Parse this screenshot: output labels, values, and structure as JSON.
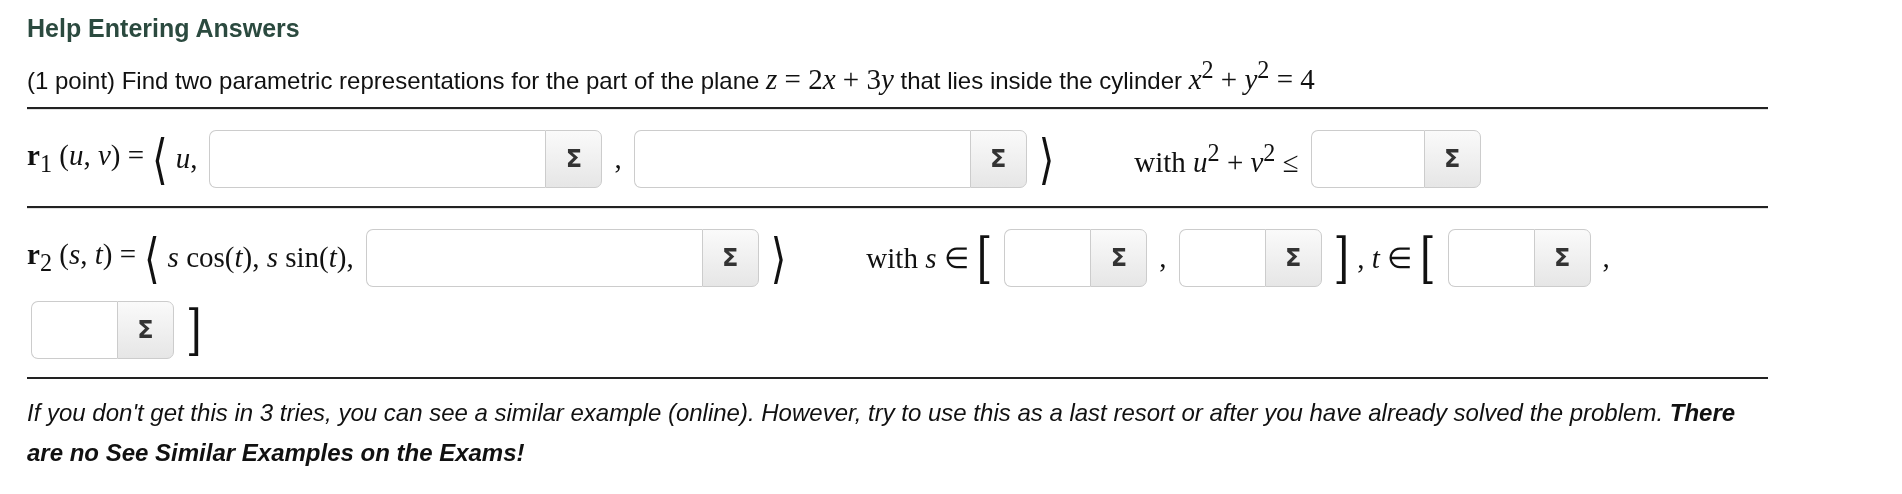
{
  "heading": "Help Entering Answers",
  "problem": [
    {
      "kind": "text",
      "text": "(1 point) Find two parametric representations for the part of the plane "
    },
    {
      "kind": "math",
      "text": "*z* = 2"
    },
    {
      "kind": "math",
      "text": "*x*"
    },
    {
      "kind": "math",
      "text": " + 3"
    },
    {
      "kind": "math",
      "text": "*y*"
    },
    {
      "kind": "text",
      "text": " that lies inside the cylinder "
    },
    {
      "kind": "math",
      "text": "*x*$^{2}$ + *y*$^{2}$ = 4"
    }
  ],
  "rows": [
    {
      "parts": [
        {
          "kind": "math",
          "text": "**r**$_{1}$ (*u*, *v*) ="
        },
        {
          "kind": "delim",
          "text": "⟨"
        },
        {
          "kind": "math",
          "text": "*u*,"
        },
        {
          "kind": "field_wide",
          "button": "Σ"
        },
        {
          "kind": "math",
          "text": ","
        },
        {
          "kind": "field_wide",
          "button": "Σ"
        },
        {
          "kind": "delim",
          "text": "⟩"
        },
        {
          "kind": "math",
          "text": "with *u*$^{2}$ + *v*$^{2}$ ≤",
          "spaced": true
        },
        {
          "kind": "field_medium",
          "button": "Σ"
        }
      ]
    },
    {
      "parts": [
        {
          "kind": "math",
          "text": "**r**$_{2}$ (*s*, *t*) ="
        },
        {
          "kind": "delim",
          "text": "⟨"
        },
        {
          "kind": "math",
          "text": "*s* cos(*t*), *s* sin(*t*),"
        },
        {
          "kind": "field_wide",
          "button": "Σ"
        },
        {
          "kind": "delim",
          "text": "⟩"
        },
        {
          "kind": "math",
          "text": "with *s* ∈",
          "spaced": true
        },
        {
          "kind": "delim",
          "text": "["
        },
        {
          "kind": "field_small",
          "button": "Σ"
        },
        {
          "kind": "math",
          "text": ","
        },
        {
          "kind": "field_small",
          "button": "Σ"
        },
        {
          "kind": "delim",
          "text": "]"
        },
        {
          "kind": "math",
          "text": ", *t* ∈"
        },
        {
          "kind": "delim",
          "text": "["
        },
        {
          "kind": "field_small",
          "button": "Σ"
        },
        {
          "kind": "math",
          "text": ","
        },
        {
          "kind": "field_small",
          "button": "Σ"
        },
        {
          "kind": "delim",
          "text": "]"
        }
      ]
    }
  ],
  "footer": "If you don't get this in 3 tries, you can see a similar example (online). However, try to use this as a last resort or after you have already solved the problem. **There are no See Similar Examples on the Exams!**"
}
